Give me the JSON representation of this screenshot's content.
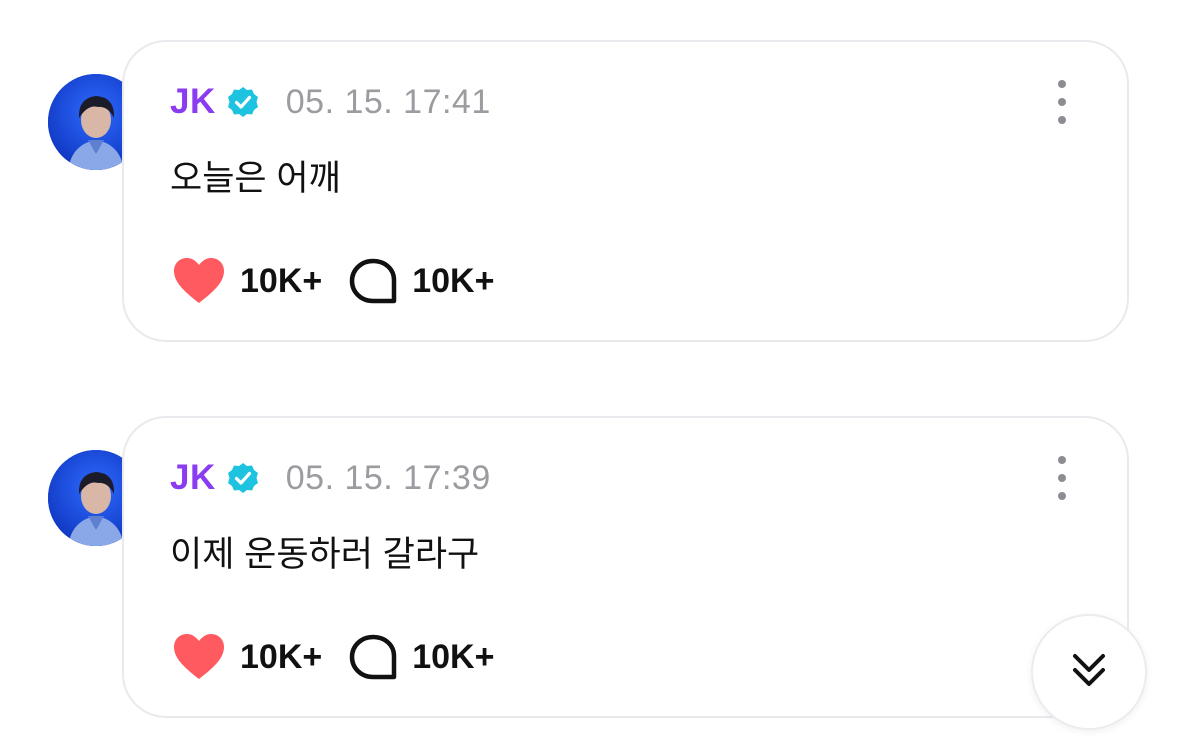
{
  "colors": {
    "author": "#8a3cf0",
    "verified": "#1ec3e0",
    "timestamp": "#9b9ba0",
    "heart": "#ff5a5f",
    "card_border": "#e9e9ee"
  },
  "posts": [
    {
      "author": "JK",
      "verified_icon": "verified-badge-icon",
      "timestamp": "05. 15. 17:41",
      "text": "오늘은 어깨",
      "likes": "10K+",
      "comments": "10K+",
      "more_icon": "more-vertical-icon"
    },
    {
      "author": "JK",
      "verified_icon": "verified-badge-icon",
      "timestamp": "05. 15. 17:39",
      "text": "이제 운동하러 갈라구",
      "likes": "10K+",
      "comments": "10K+",
      "more_icon": "more-vertical-icon"
    }
  ],
  "scroll_button": {
    "icon": "double-chevron-down-icon"
  }
}
